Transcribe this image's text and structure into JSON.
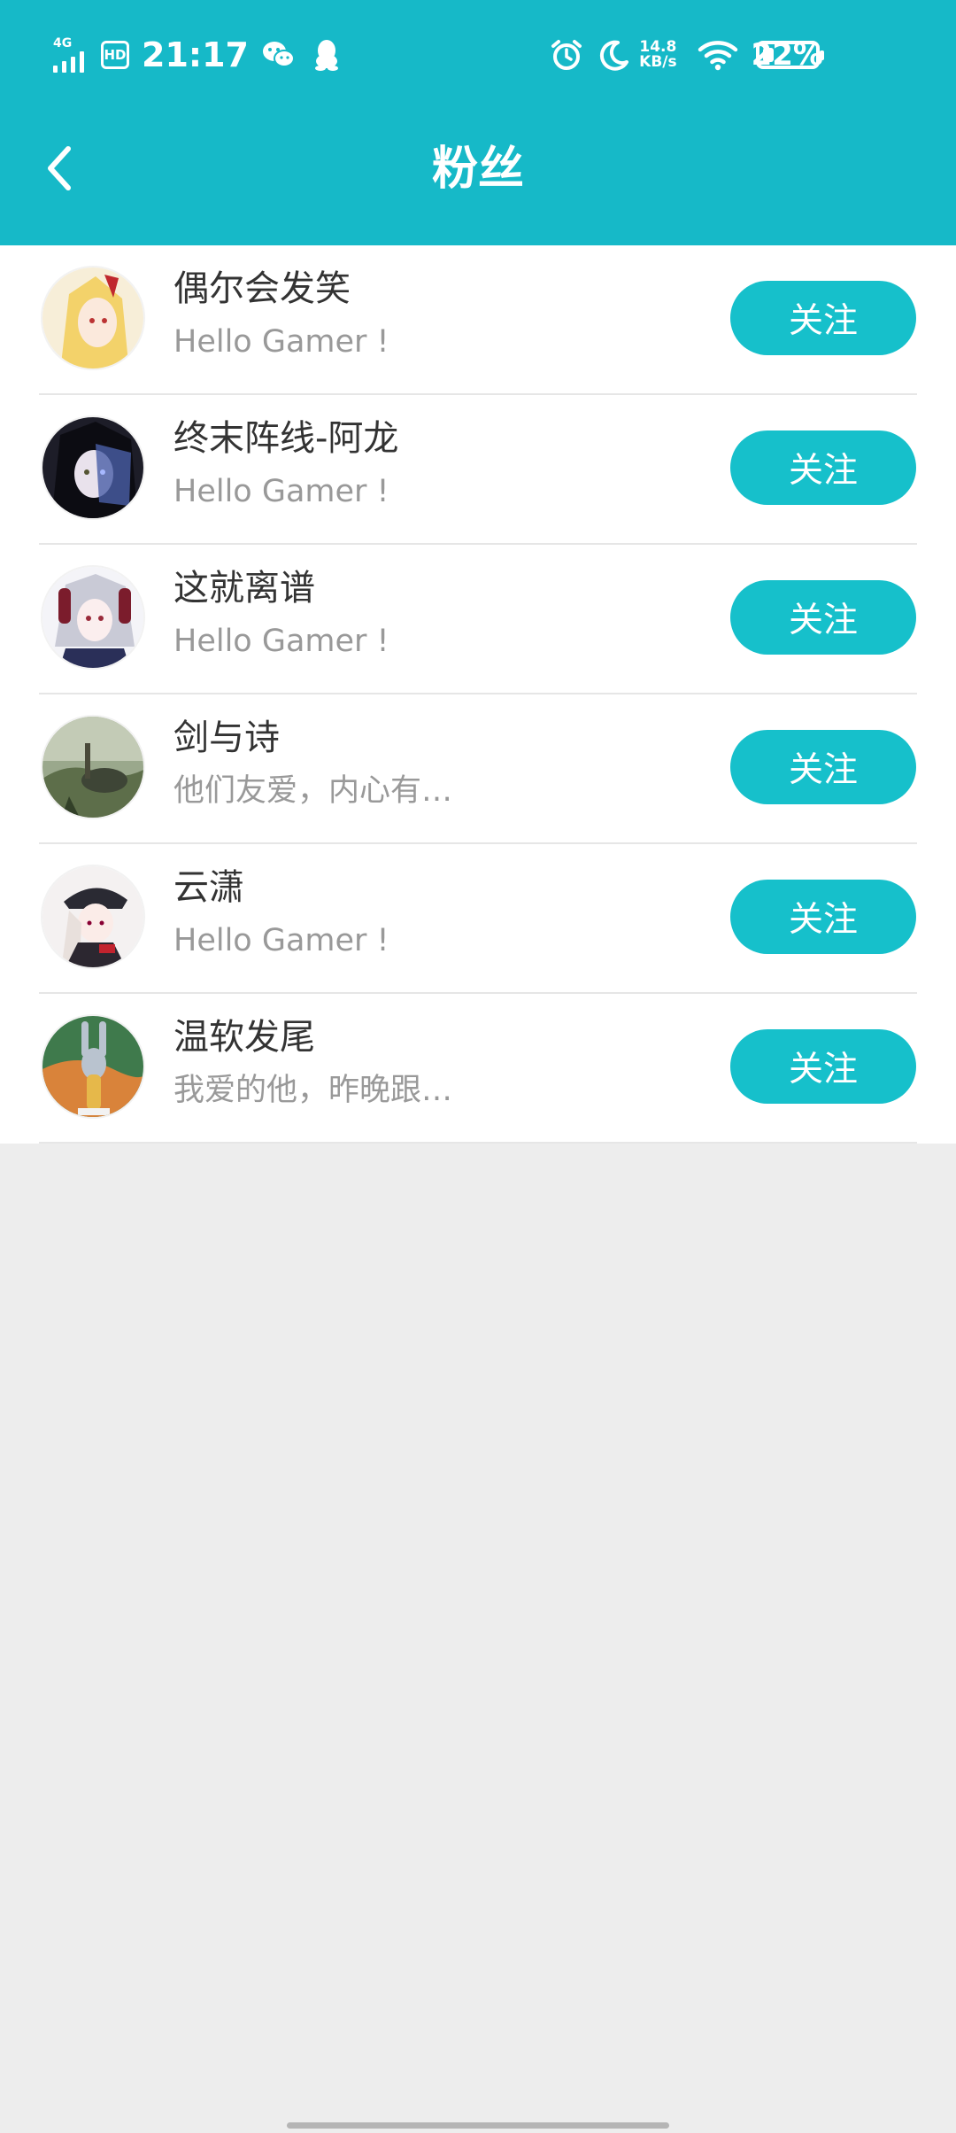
{
  "status_bar": {
    "network": "4G",
    "hd": "HD",
    "time": "21:17",
    "net_speed_value": "14.8",
    "net_speed_unit": "KB/s",
    "battery_percent": "22%",
    "battery_level": 0.22,
    "icons": [
      "signal-icon",
      "wechat-icon",
      "qq-icon",
      "alarm-icon",
      "moon-icon",
      "wifi-icon",
      "battery-icon"
    ]
  },
  "header": {
    "title": "粉丝",
    "back_icon": "chevron-left-icon",
    "background": "#16b9c8"
  },
  "followers": [
    {
      "name": "偶尔会发笑",
      "bio": "Hello Gamer !",
      "button": "关注"
    },
    {
      "name": "终末阵线-阿龙",
      "bio": "Hello Gamer !",
      "button": "关注"
    },
    {
      "name": "这就离谱",
      "bio": "Hello Gamer !",
      "button": "关注"
    },
    {
      "name": "剑与诗",
      "bio": "他们友爱，内心有…",
      "button": "关注"
    },
    {
      "name": "云潇",
      "bio": "Hello Gamer !",
      "button": "关注"
    },
    {
      "name": "温软发尾",
      "bio": "我爱的他，昨晚跟…",
      "button": "关注"
    }
  ],
  "colors": {
    "accent": "#16c0cb",
    "name_text": "#333333",
    "bio_text": "#999999",
    "page_bg": "#ededed"
  }
}
